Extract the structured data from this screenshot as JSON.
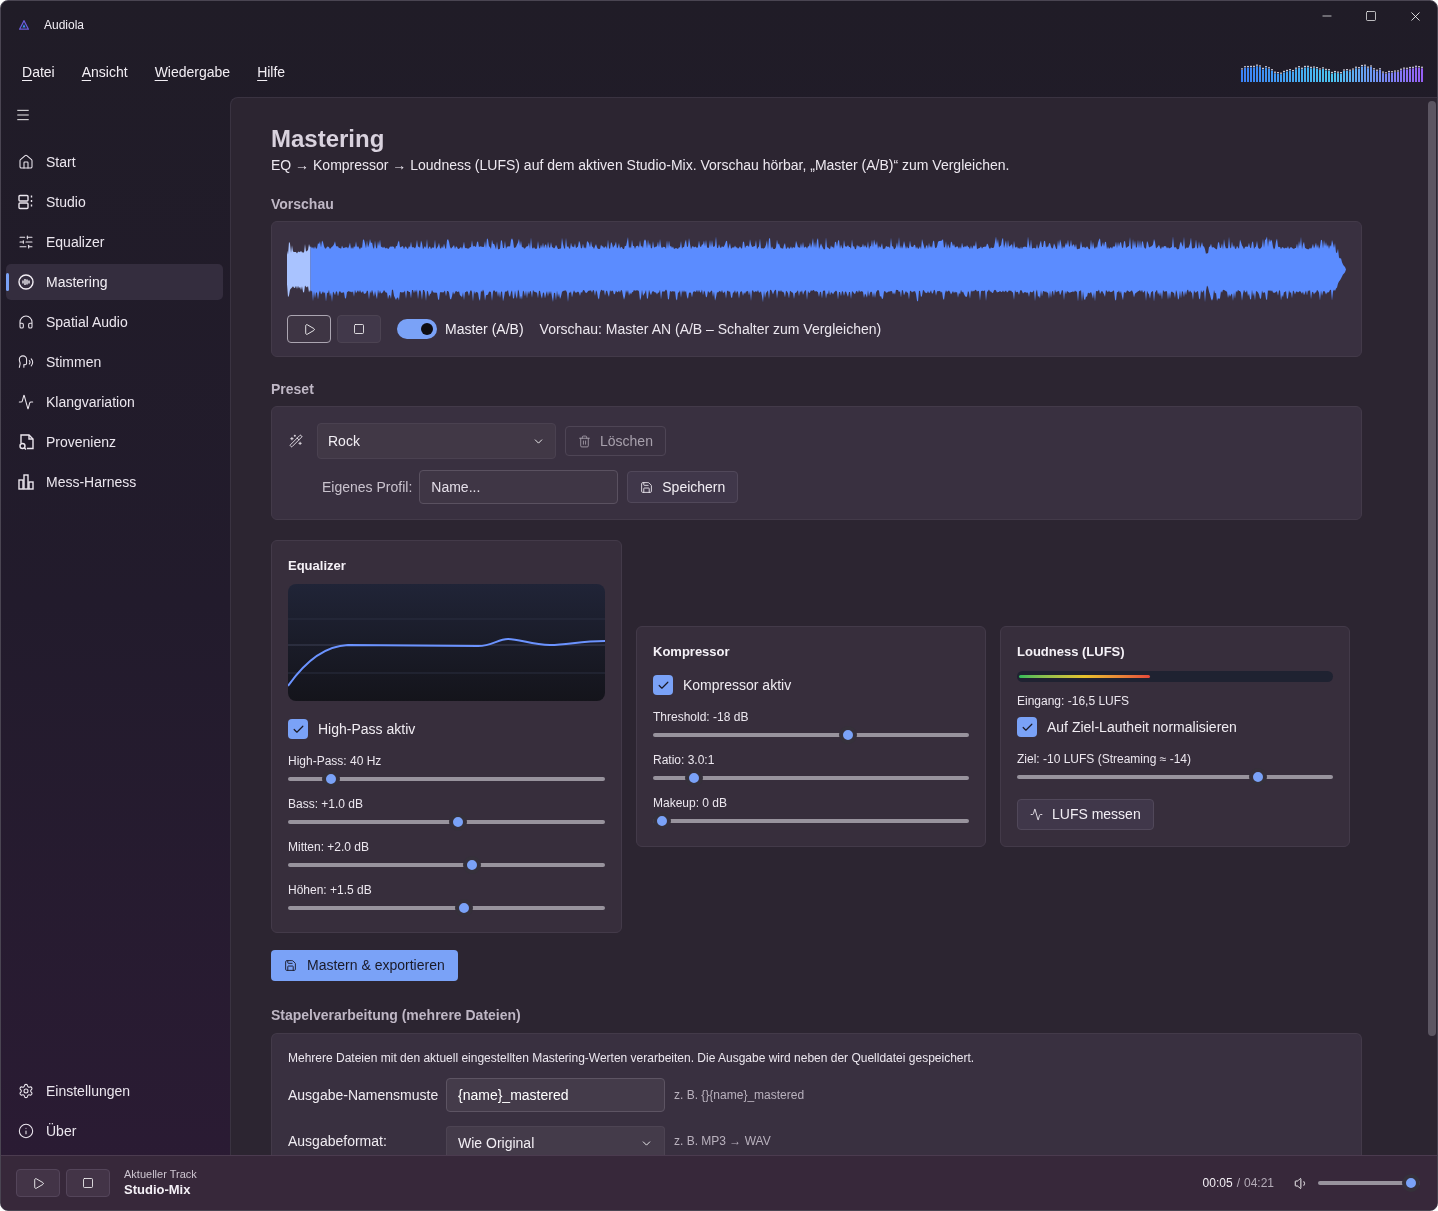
{
  "window": {
    "title": "Audiola"
  },
  "menu": [
    "Datei",
    "Ansicht",
    "Wiedergabe",
    "Hilfe"
  ],
  "sidebar": {
    "items": [
      {
        "label": "Start",
        "selected": false
      },
      {
        "label": "Studio",
        "selected": false
      },
      {
        "label": "Equalizer",
        "selected": false
      },
      {
        "label": "Mastering",
        "selected": true
      },
      {
        "label": "Spatial Audio",
        "selected": false
      },
      {
        "label": "Stimmen",
        "selected": false
      },
      {
        "label": "Klangvariation",
        "selected": false
      },
      {
        "label": "Provenienz",
        "selected": false
      },
      {
        "label": "Mess-Harness",
        "selected": false
      }
    ],
    "footer_items": [
      {
        "label": "Einstellungen",
        "selected": false
      },
      {
        "label": "Über",
        "selected": false
      }
    ]
  },
  "page": {
    "title": "Mastering",
    "description": "EQ → Kompressor → Loudness (LUFS) auf dem aktiven Studio-Mix. Vorschau hörbar, „Master (A/B)“ zum Vergleichen."
  },
  "preview": {
    "heading": "Vorschau",
    "waveform": {
      "level": 0.022
    },
    "buttons": [
      {
        "kind": "play",
        "focused": true
      },
      {
        "kind": "stop",
        "focused": false
      }
    ],
    "toggle": {
      "label": "Master (A/B)",
      "on": true
    },
    "status": "Vorschau: Master AN (A/B – Schalter zum Vergleichen)"
  },
  "preset": {
    "heading": "Preset",
    "dropdown": {
      "value": "Rock"
    },
    "delete_button": {
      "label": "Löschen",
      "disabled": true
    },
    "custom_profile": {
      "label": "Eigenes Profil:",
      "placeholder": "Name..."
    },
    "save_button": {
      "label": "Speichern"
    }
  },
  "equalizer": {
    "title": "Equalizer",
    "checkbox": {
      "label": "High-Pass aktiv",
      "checked": true
    },
    "sliders": [
      {
        "label": "High-Pass: 40 Hz",
        "level": 0.115
      },
      {
        "label": "Bass: +1.0 dB",
        "level": 0.54
      },
      {
        "label": "Mitten: +2.0 dB",
        "level": 0.585
      },
      {
        "label": "Höhen: +1.5 dB",
        "level": 0.56
      }
    ]
  },
  "compressor": {
    "title": "Kompressor",
    "checkbox": {
      "label": "Kompressor aktiv",
      "checked": true
    },
    "sliders": [
      {
        "label": "Threshold: -18 dB",
        "level": 0.625
      },
      {
        "label": "Ratio: 3.0:1",
        "level": 0.107
      },
      {
        "label": "Makeup: 0 dB",
        "level": 0
      }
    ]
  },
  "loudness": {
    "title": "Loudness (LUFS)",
    "meter": {
      "level": 0.42
    },
    "input_reading": "Eingang: -16,5 LUFS",
    "checkbox": {
      "label": "Auf Ziel-Lautheit normalisieren",
      "checked": true
    },
    "target": {
      "label": "Ziel: -10 LUFS (Streaming ≈ -14)",
      "level": 0.78
    },
    "measure_button": {
      "label": "LUFS messen"
    }
  },
  "export_button": {
    "label": "Mastern & exportieren"
  },
  "batch": {
    "heading": "Stapelverarbeitung (mehrere Dateien)",
    "description": "Mehrere Dateien mit den aktuell eingestellten Mastering-Werten verarbeiten. Die Ausgabe wird neben der Quelldatei gespeichert.",
    "fields": [
      {
        "kind": "text",
        "label": "Ausgabe-Namensmuste",
        "value": "{name}_mastered",
        "hint": "z. B. {}{name}_mastered"
      },
      {
        "kind": "select",
        "label": "Ausgabeformat:",
        "value": "Wie Original",
        "hint": "z. B. MP3 → WAV"
      }
    ]
  },
  "player": {
    "caption": "Aktueller Track",
    "track": "Studio-Mix",
    "elapsed": "00:05",
    "separator": "/",
    "duration": "04:21",
    "volume": {
      "level": 1
    }
  }
}
